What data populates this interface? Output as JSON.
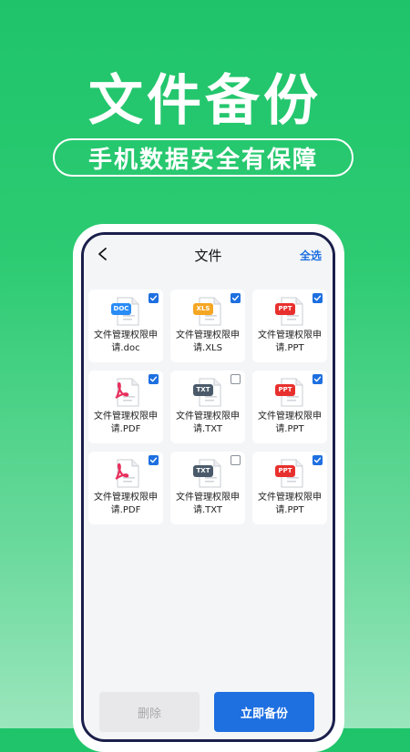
{
  "hero": {
    "title": "文件备份",
    "subtitle": "手机数据安全有保障"
  },
  "app": {
    "title": "文件",
    "select_all": "全选"
  },
  "files": [
    {
      "name": "文件管理权限申请.doc",
      "badge": "DOC",
      "type": "doc-icon",
      "checked": true
    },
    {
      "name": "文件管理权限申请.XLS",
      "badge": "XLS",
      "type": "xls-icon",
      "checked": true
    },
    {
      "name": "文件管理权限申请.PPT",
      "badge": "PPT",
      "type": "ppt-icon",
      "checked": true
    },
    {
      "name": "文件管理权限申请.PDF",
      "badge": "",
      "type": "pdf-icon",
      "checked": true
    },
    {
      "name": "文件管理权限申请.TXT",
      "badge": "TXT",
      "type": "txt-icon",
      "checked": false
    },
    {
      "name": "文件管理权限申请.PPT",
      "badge": "PPT",
      "type": "ppt-icon",
      "checked": true
    },
    {
      "name": "文件管理权限申请.PDF",
      "badge": "",
      "type": "pdf-icon",
      "checked": true
    },
    {
      "name": "文件管理权限申请.TXT",
      "badge": "TXT",
      "type": "txt-icon",
      "checked": false
    },
    {
      "name": "文件管理权限申请.PPT",
      "badge": "PPT",
      "type": "ppt-icon",
      "checked": true
    }
  ],
  "actions": {
    "delete_label": "删除",
    "backup_label": "立即备份"
  },
  "colors": {
    "accent": "#1e6fe0",
    "doc": "#2a8cf5",
    "xls": "#f5a623",
    "ppt": "#e8302e",
    "pdf": "#e8305d",
    "txt": "#4a5a6a"
  }
}
